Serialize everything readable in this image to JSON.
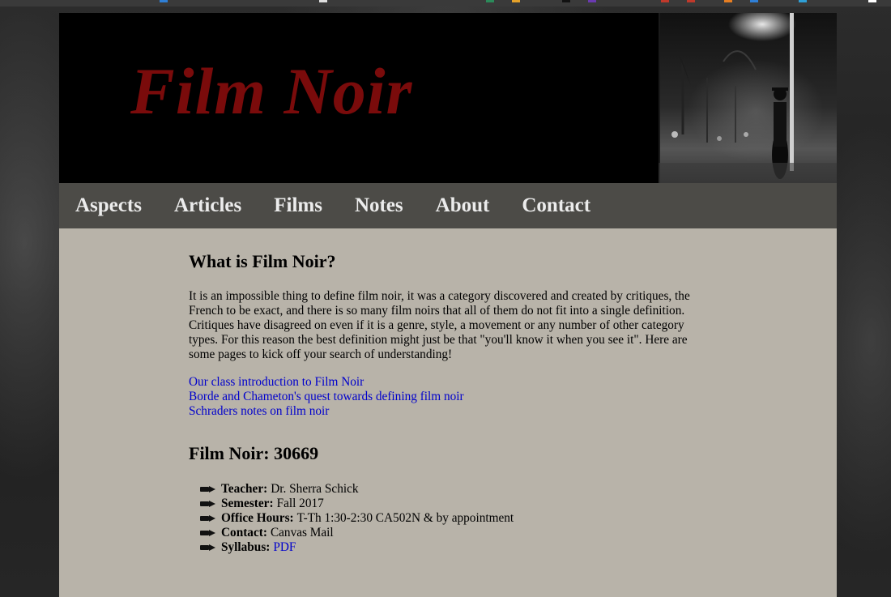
{
  "site": {
    "title": "Film Noir"
  },
  "nav": {
    "items": [
      "Aspects",
      "Articles",
      "Films",
      "Notes",
      "About",
      "Contact"
    ]
  },
  "intro_section": {
    "heading": "What is Film Noir?",
    "paragraph": "It is an impossible thing to define film noir, it was a category discovered and created by critiques, the French to be exact, and there is so many film noirs that all of them do not fit into a single definition. Critiques have disagreed on even if it is a genre, style, a movement or any number of other category types. For this reason the best definition might just be that \"you'll know it when you see it\". Here are some pages to kick off your search of understanding!",
    "links": [
      "Our class introduction to Film Noir",
      "Borde and Chameton's quest towards defining film noir",
      "Schraders notes on film noir"
    ]
  },
  "course": {
    "heading": "Film Noir: 30669",
    "items": [
      {
        "label": "Teacher:",
        "value": "Dr. Sherra Schick"
      },
      {
        "label": "Semester:",
        "value": "Fall 2017"
      },
      {
        "label": "Office Hours:",
        "value": "T-Th 1:30-2:30 CA502N & by appointment"
      },
      {
        "label": "Contact:",
        "value": "Canvas Mail"
      },
      {
        "label": "Syllabus:",
        "link": "PDF"
      }
    ]
  },
  "icons": {
    "bullet": "pointing-hand-icon",
    "header_image": "noir-street-photo"
  },
  "colors": {
    "title": "#7a0b0b",
    "nav_bg": "#4c4b47",
    "nav_text": "#ececec",
    "content_bg": "#b8b3a9",
    "link": "#0000cc"
  }
}
